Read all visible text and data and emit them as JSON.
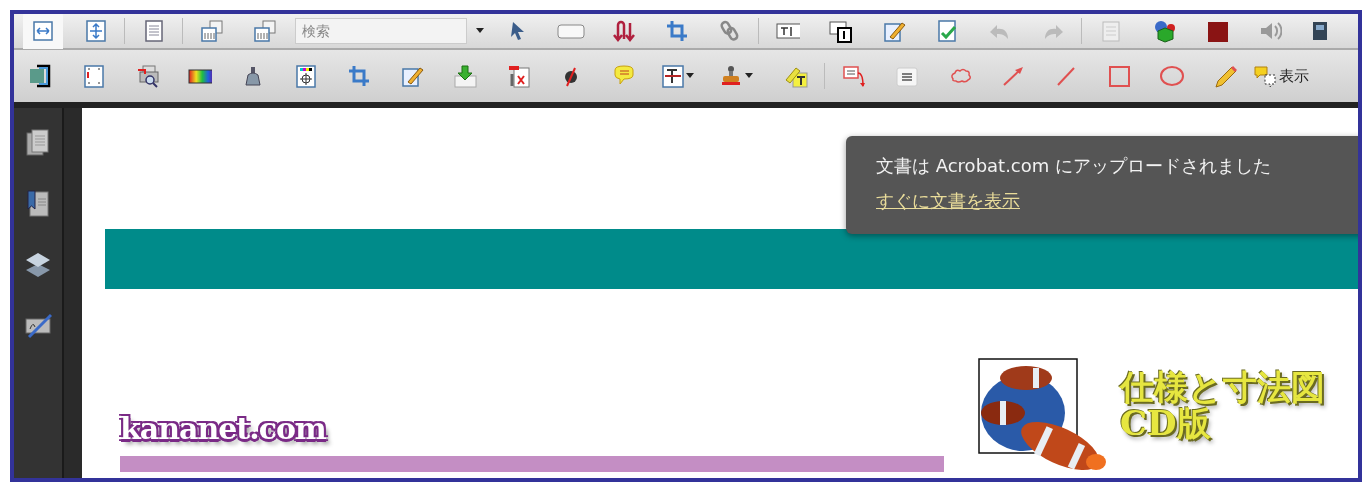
{
  "toolbar_top": {
    "search_field": {
      "placeholder": "検索"
    }
  },
  "toolbar_tools": {
    "label": "表示"
  },
  "notification": {
    "message": "文書は Acrobat.com にアップロードされました",
    "link": "すぐに文書を表示"
  },
  "document": {
    "logo": "kananet.com",
    "heading": [
      "仕様と寸法図",
      "CD版"
    ]
  }
}
